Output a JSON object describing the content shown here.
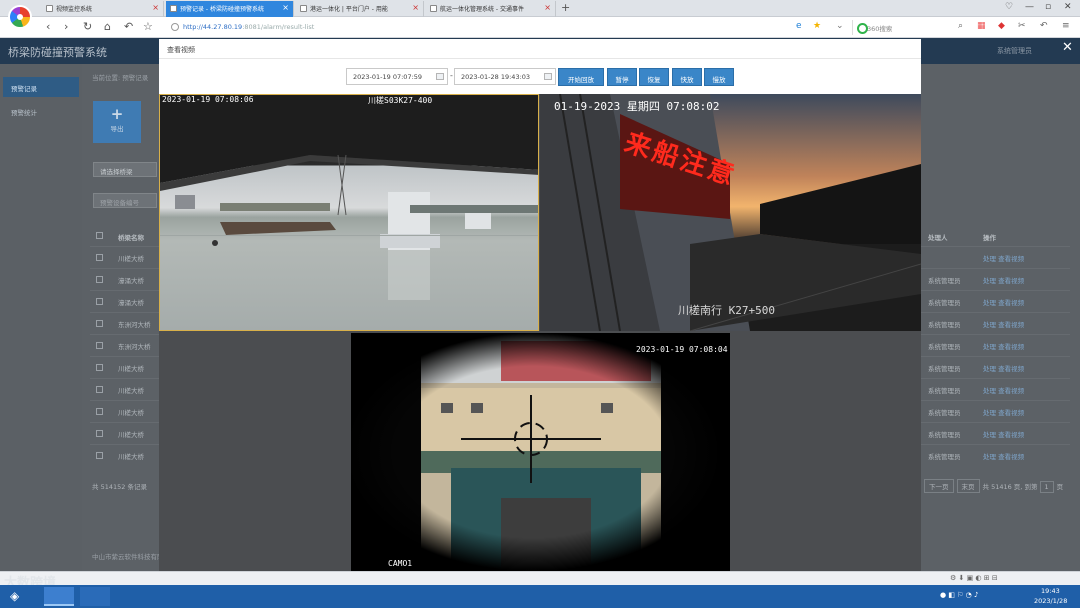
{
  "browser": {
    "tabs": [
      {
        "title": "视频监控系统",
        "active": false
      },
      {
        "title": "预警记录 - 桥梁防碰撞预警系统",
        "active": true
      },
      {
        "title": "港运一体化 | 平台门户 - 用能",
        "active": false
      },
      {
        "title": "航运一体化管理系统 - 交通事件",
        "active": false
      }
    ],
    "url_host": "http://44.27.80.19",
    "url_rest": ":8081/alarm/result-list",
    "search_placeholder": "360搜索"
  },
  "app": {
    "title": "桥梁防碰撞预警系统",
    "user_label": "系统管理员",
    "sidebar": [
      {
        "label": "预警记录",
        "active": true
      },
      {
        "label": "预警统计",
        "active": false
      }
    ],
    "breadcrumb": "当前位置: 预警记录",
    "export_label": "导出",
    "select_placeholder": "请选择桥梁",
    "input_placeholder": "预警设备编号",
    "columns": {
      "name": "桥梁名称",
      "handler": "处理人",
      "ops": "操作"
    },
    "rows": [
      {
        "name": "川槎大桥",
        "handler": "",
        "ops": "处理  查看视频"
      },
      {
        "name": "濠涌大桥",
        "handler": "系统管理员",
        "ops": "处理  查看视频"
      },
      {
        "name": "濠涌大桥",
        "handler": "系统管理员",
        "ops": "处理  查看视频"
      },
      {
        "name": "东洲河大桥",
        "handler": "系统管理员",
        "ops": "处理  查看视频"
      },
      {
        "name": "东洲河大桥",
        "handler": "系统管理员",
        "ops": "处理  查看视频"
      },
      {
        "name": "川槎大桥",
        "handler": "系统管理员",
        "ops": "处理  查看视频"
      },
      {
        "name": "川槎大桥",
        "handler": "系统管理员",
        "ops": "处理  查看视频"
      },
      {
        "name": "川槎大桥",
        "handler": "系统管理员",
        "ops": "处理  查看视频"
      },
      {
        "name": "川槎大桥",
        "handler": "系统管理员",
        "ops": "处理  查看视频"
      },
      {
        "name": "川槎大桥",
        "handler": "系统管理员",
        "ops": "处理  查看视频"
      }
    ],
    "total": "共 514152 条记录",
    "pager_next": "下一页",
    "pager_last": "末页",
    "pager_info": "共 51416 页, 到第",
    "pager_page": "1",
    "pager_suffix": "页",
    "footer": "中山市紫云软件科技有限公司"
  },
  "modal": {
    "title": "查看视频",
    "start_time": "2023-01-19 07:07:59",
    "end_time": "2023-01-28 19:43:03",
    "separator": "-",
    "buttons": [
      "开始回放",
      "暂停",
      "恢复",
      "快放",
      "慢放"
    ],
    "close": "✕"
  },
  "videos": [
    {
      "timestamp": "2023-01-19 07:08:06",
      "label": "川槎S03K27-400"
    },
    {
      "timestamp": "01-19-2023 星期四 07:08:02",
      "label": "川槎南行 K27+500",
      "sign": "来船注意"
    },
    {
      "timestamp": "2023-01-19 07:08:04",
      "label": "CAMO1"
    }
  ],
  "taskbar": {
    "time": "19:43",
    "date": "2023/1/28",
    "watermark": "大数跨境"
  }
}
